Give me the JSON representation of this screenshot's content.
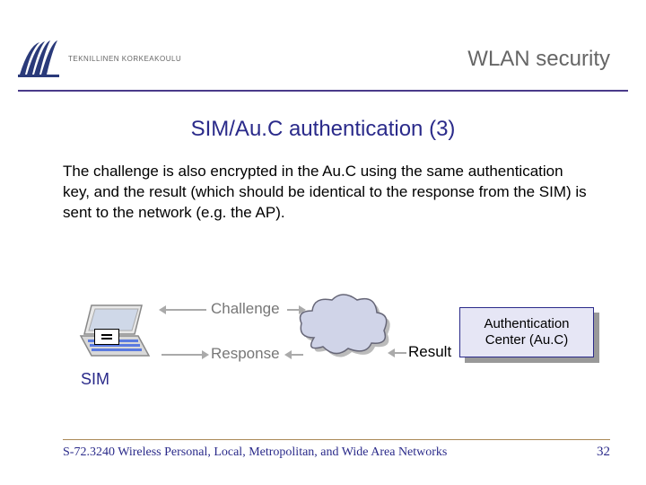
{
  "header": {
    "org": "TEKNILLINEN KORKEAKOULU",
    "title": "WLAN security"
  },
  "slide": {
    "title": "SIM/Au.C authentication (3)",
    "body": "The challenge is also encrypted in the Au.C using the same authentication key, and the result (which should be identical to the response from the SIM) is sent to the network (e.g. the AP)."
  },
  "diagram": {
    "sim": "SIM",
    "challenge": "Challenge",
    "response": "Response",
    "result": "Result",
    "auc_line1": "Authentication",
    "auc_line2": "Center (Au.C)"
  },
  "footer": {
    "course": "S-72.3240 Wireless Personal, Local, Metropolitan, and Wide Area Networks",
    "page": "32"
  }
}
